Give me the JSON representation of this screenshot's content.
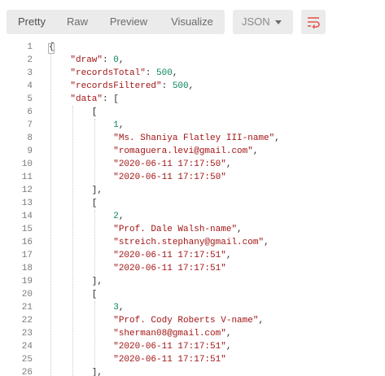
{
  "toolbar": {
    "tabs": [
      "Pretty",
      "Raw",
      "Preview",
      "Visualize"
    ],
    "active_tab": "Pretty",
    "format": "JSON",
    "icons": {
      "dropdown": "chevron-down-icon",
      "wrap": "wrap-lines-icon"
    },
    "accent": "#e8554e"
  },
  "lines": [
    {
      "n": "1",
      "text": "{"
    },
    {
      "n": "2",
      "text": "    \"draw\": 0,"
    },
    {
      "n": "3",
      "text": "    \"recordsTotal\": 500,"
    },
    {
      "n": "4",
      "text": "    \"recordsFiltered\": 500,"
    },
    {
      "n": "5",
      "text": "    \"data\": ["
    },
    {
      "n": "6",
      "text": "        ["
    },
    {
      "n": "7",
      "text": "            1,"
    },
    {
      "n": "8",
      "text": "            \"Ms. Shaniya Flatley III-name\","
    },
    {
      "n": "9",
      "text": "            \"romaguera.levi@gmail.com\","
    },
    {
      "n": "10",
      "text": "            \"2020-06-11 17:17:50\","
    },
    {
      "n": "11",
      "text": "            \"2020-06-11 17:17:50\""
    },
    {
      "n": "12",
      "text": "        ],"
    },
    {
      "n": "13",
      "text": "        ["
    },
    {
      "n": "14",
      "text": "            2,"
    },
    {
      "n": "15",
      "text": "            \"Prof. Dale Walsh-name\","
    },
    {
      "n": "16",
      "text": "            \"streich.stephany@gmail.com\","
    },
    {
      "n": "17",
      "text": "            \"2020-06-11 17:17:51\","
    },
    {
      "n": "18",
      "text": "            \"2020-06-11 17:17:51\""
    },
    {
      "n": "19",
      "text": "        ],"
    },
    {
      "n": "20",
      "text": "        ["
    },
    {
      "n": "21",
      "text": "            3,"
    },
    {
      "n": "22",
      "text": "            \"Prof. Cody Roberts V-name\","
    },
    {
      "n": "23",
      "text": "            \"sherman08@gmail.com\","
    },
    {
      "n": "24",
      "text": "            \"2020-06-11 17:17:51\","
    },
    {
      "n": "25",
      "text": "            \"2020-06-11 17:17:51\""
    },
    {
      "n": "26",
      "text": "        ],"
    }
  ]
}
